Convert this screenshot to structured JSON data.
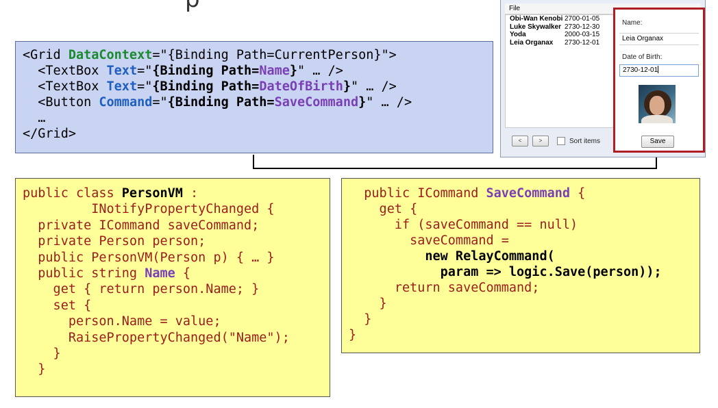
{
  "title_fragment": "p",
  "xaml_code": [
    [
      {
        "t": "<Grid ",
        "c": "plain"
      },
      {
        "t": "DataContext",
        "c": "green"
      },
      {
        "t": "=\"{Binding Path=CurrentPerson}\">",
        "c": "plain"
      }
    ],
    [
      {
        "t": "  <TextBox ",
        "c": "plain"
      },
      {
        "t": "Text",
        "c": "kw"
      },
      {
        "t": "=\"",
        "c": "plain"
      },
      {
        "t": "{Binding Path=",
        "c": "bold"
      },
      {
        "t": "Name",
        "c": "purple"
      },
      {
        "t": "}",
        "c": "bold"
      },
      {
        "t": "\" … />",
        "c": "plain"
      }
    ],
    [
      {
        "t": "  <TextBox ",
        "c": "plain"
      },
      {
        "t": "Text",
        "c": "kw"
      },
      {
        "t": "=\"",
        "c": "plain"
      },
      {
        "t": "{Binding Path=",
        "c": "bold"
      },
      {
        "t": "DateOfBirth",
        "c": "purple"
      },
      {
        "t": "}",
        "c": "bold"
      },
      {
        "t": "\" … />",
        "c": "plain"
      }
    ],
    [
      {
        "t": "  <Button ",
        "c": "plain"
      },
      {
        "t": "Command",
        "c": "kw"
      },
      {
        "t": "=\"",
        "c": "plain"
      },
      {
        "t": "{Binding Path=",
        "c": "bold"
      },
      {
        "t": "SaveCommand",
        "c": "purple"
      },
      {
        "t": "}",
        "c": "bold"
      },
      {
        "t": "\" … />",
        "c": "plain"
      }
    ],
    [
      {
        "t": "  …",
        "c": "plain"
      }
    ],
    [
      {
        "t": "</Grid>",
        "c": "plain"
      }
    ]
  ],
  "personvm_code": [
    [
      {
        "t": "public class ",
        "c": "red"
      },
      {
        "t": "PersonVM",
        "c": "bold"
      },
      {
        "t": " :",
        "c": "red"
      }
    ],
    [
      {
        "t": "         INotifyPropertyChanged {",
        "c": "red"
      }
    ],
    [
      {
        "t": "  private ICommand saveCommand;",
        "c": "red"
      }
    ],
    [
      {
        "t": "  private Person person;",
        "c": "red"
      }
    ],
    [
      {
        "t": "  public PersonVM(Person p) { … }",
        "c": "red"
      }
    ],
    [
      {
        "t": "  public string ",
        "c": "red"
      },
      {
        "t": "Name",
        "c": "purple"
      },
      {
        "t": " {",
        "c": "red"
      }
    ],
    [
      {
        "t": "    get { return person.Name; }",
        "c": "red"
      }
    ],
    [
      {
        "t": "    set {",
        "c": "red"
      }
    ],
    [
      {
        "t": "      person.Name = value;",
        "c": "red"
      }
    ],
    [
      {
        "t": "      RaisePropertyChanged(\"Name\");",
        "c": "red"
      }
    ],
    [
      {
        "t": "    }",
        "c": "red"
      }
    ],
    [
      {
        "t": "  }",
        "c": "red"
      }
    ]
  ],
  "savecommand_code": [
    [
      {
        "t": "  public ICommand ",
        "c": "red"
      },
      {
        "t": "SaveCommand",
        "c": "purple"
      },
      {
        "t": " {",
        "c": "red"
      }
    ],
    [
      {
        "t": "    get {",
        "c": "red"
      }
    ],
    [
      {
        "t": "      if (saveCommand == null)",
        "c": "red"
      }
    ],
    [
      {
        "t": "        saveCommand =",
        "c": "red"
      }
    ],
    [
      {
        "t": "          new RelayCommand(",
        "c": "bold"
      }
    ],
    [
      {
        "t": "            param => logic.Save(person));",
        "c": "bold"
      }
    ],
    [
      {
        "t": "      return saveCommand;",
        "c": "red"
      }
    ],
    [
      {
        "t": "    }",
        "c": "red"
      }
    ],
    [
      {
        "t": "  }",
        "c": "red"
      }
    ],
    [
      {
        "t": "}",
        "c": "red"
      }
    ]
  ],
  "app": {
    "menu_file": "File",
    "people": [
      {
        "name": "Obi-Wan Kenobi",
        "dob": "2700-01-05"
      },
      {
        "name": "Luke Skywalker",
        "dob": "2730-12-30"
      },
      {
        "name": "Yoda",
        "dob": "2000-03-15"
      },
      {
        "name": "Leia Organax",
        "dob": "2730-12-01"
      }
    ],
    "nav_prev": "<",
    "nav_next": ">",
    "sort_label": "Sort items",
    "detail": {
      "name_label": "Name:",
      "name_value": "Leia Organax",
      "dob_label": "Date of Birth:",
      "dob_value": "2730-12-01",
      "save_label": "Save"
    }
  },
  "colors": {
    "xaml_bg": "#c9d3f2",
    "code_bg": "#ffff99",
    "highlight_border": "#b01e24",
    "keyword_blue": "#1f5fbf",
    "keyword_green": "#1a8a2e",
    "keyword_purple": "#7a3fb5",
    "code_red": "#9b1c1c"
  }
}
